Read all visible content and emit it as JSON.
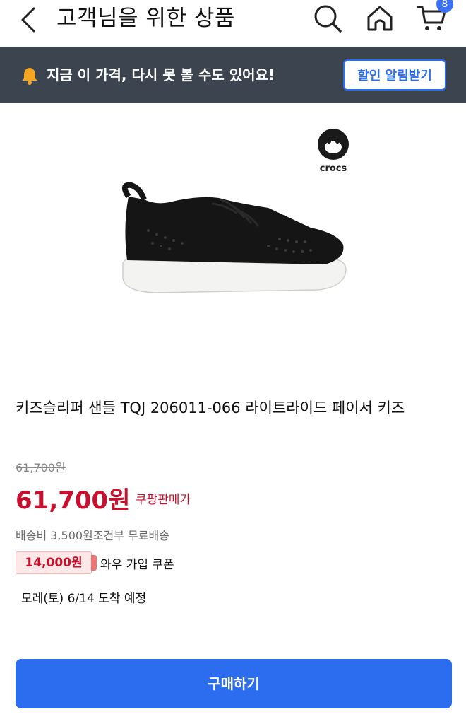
{
  "header": {
    "title": "고객님을 위한 상품",
    "cart_count": "8",
    "icons": [
      "back-icon",
      "search-icon",
      "home-icon",
      "cart-icon"
    ]
  },
  "banner": {
    "text": "지금 이 가격, 다시 못 볼 수도 있어요!",
    "button_label": "할인 알림받기"
  },
  "product": {
    "brand_logo_text": "crocs",
    "name": "키즈슬리퍼 샌들 TQJ 206011-066 라이트라이드 페이서 키즈",
    "original_price": "61,700원",
    "sale_price": "61,700원",
    "price_label": "쿠팡판매가",
    "shipping": "배송비 3,500원조건부 무료배송",
    "coupon_amount": "14,000원",
    "coupon_label": "와우 가입 쿠폰",
    "delivery": "모레(토) 6/14 도착 예정"
  },
  "actions": {
    "buy_label": "구매하기"
  },
  "colors": {
    "accent": "#2c6df0",
    "price": "#c8102e",
    "banner_bg": "#3c4450"
  }
}
